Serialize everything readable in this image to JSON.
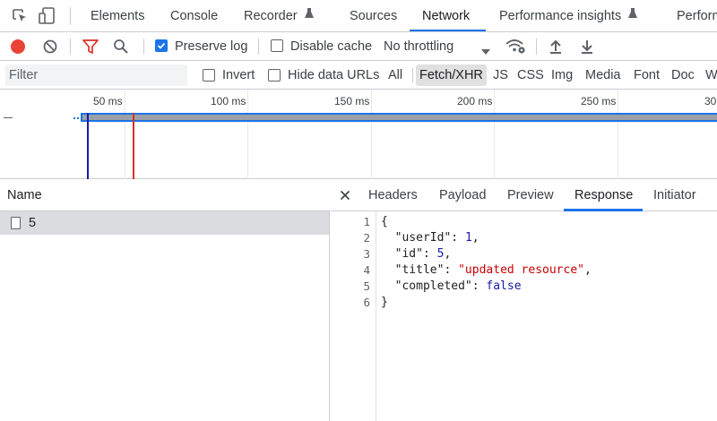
{
  "tabs": {
    "items": [
      {
        "label": "Elements"
      },
      {
        "label": "Console"
      },
      {
        "label": "Recorder"
      },
      {
        "label": "Sources"
      },
      {
        "label": "Network"
      },
      {
        "label": "Performance insights"
      },
      {
        "label": "Perform"
      }
    ],
    "active": "Network"
  },
  "toolbar": {
    "preserve_log_label": "Preserve log",
    "preserve_log_checked": true,
    "disable_cache_label": "Disable cache",
    "disable_cache_checked": false,
    "throttling_value": "No throttling"
  },
  "filterbar": {
    "filter_placeholder": "Filter",
    "invert_label": "Invert",
    "hide_data_urls_label": "Hide data URLs",
    "types": [
      {
        "label": "All"
      },
      {
        "label": "Fetch/XHR"
      },
      {
        "label": "JS"
      },
      {
        "label": "CSS"
      },
      {
        "label": "Img"
      },
      {
        "label": "Media"
      },
      {
        "label": "Font"
      },
      {
        "label": "Doc"
      },
      {
        "label": "W"
      }
    ],
    "active_type": "Fetch/XHR"
  },
  "overview": {
    "ticks": [
      "50 ms",
      "100 ms",
      "150 ms",
      "200 ms",
      "250 ms",
      "30"
    ]
  },
  "requests": {
    "column_header": "Name",
    "rows": [
      {
        "name": "5"
      }
    ]
  },
  "details": {
    "tabs": [
      {
        "label": "Headers"
      },
      {
        "label": "Payload"
      },
      {
        "label": "Preview"
      },
      {
        "label": "Response"
      },
      {
        "label": "Initiator"
      }
    ],
    "active_tab": "Response",
    "response_lines": [
      {
        "n": "1",
        "text": "{"
      },
      {
        "n": "2",
        "key": "\"userId\"",
        "value": "1",
        "vtype": "num",
        "comma": ","
      },
      {
        "n": "3",
        "key": "\"id\"",
        "value": "5",
        "vtype": "num",
        "comma": ","
      },
      {
        "n": "4",
        "key": "\"title\"",
        "value": "\"updated resource\"",
        "vtype": "str",
        "comma": ","
      },
      {
        "n": "5",
        "key": "\"completed\"",
        "value": "false",
        "vtype": "kw",
        "comma": ""
      },
      {
        "n": "6",
        "text": "}"
      }
    ]
  },
  "colors": {
    "accent": "#1a73e8",
    "record": "#ea4335",
    "filter_icon": "#d93025",
    "overview_bar": "#1a73e8",
    "dom_loaded_line": "#1a1aa6",
    "load_line": "#d93025"
  }
}
